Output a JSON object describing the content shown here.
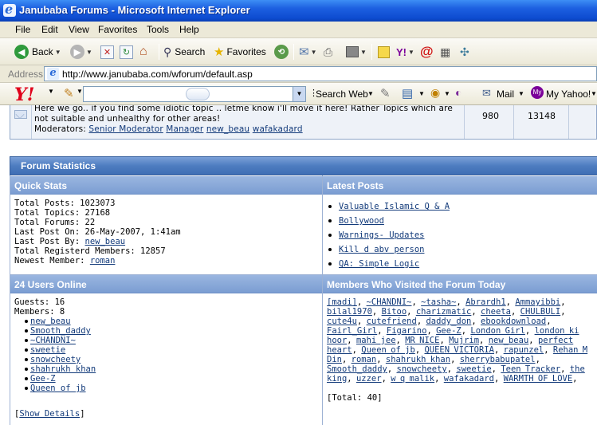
{
  "window": {
    "title": "Janubaba Forums - Microsoft Internet Explorer"
  },
  "menu": [
    "File",
    "Edit",
    "View",
    "Favorites",
    "Tools",
    "Help"
  ],
  "toolbar": {
    "back_label": "Back",
    "search_label": "Search",
    "favorites_label": "Favorites"
  },
  "address": {
    "label": "Address",
    "url": "http://www.janubaba.com/wforum/default.asp"
  },
  "yahoo": {
    "search_web_label": "Search Web",
    "mail_label": "Mail",
    "my_yahoo_label": "My Yahoo!"
  },
  "forum": {
    "description": "Here we go.. if you find some idiotic topic .. letme know i'll move it here! Rather Topics which are not suitable and unhealthy for other areas!",
    "moderators_label": "Moderators:",
    "moderators": [
      "Senior Moderator",
      "Manager",
      "new_beau",
      "wafakadard"
    ],
    "topics": "980",
    "posts": "13148"
  },
  "stats": {
    "title": "Forum Statistics",
    "quick_stats_title": "Quick Stats",
    "latest_posts_title": "Latest Posts",
    "lines": [
      "Total Posts: 1023073",
      "Total Topics: 27168",
      "Total Forums: 22",
      "Last Post On: 26-May-2007, 1:41am"
    ],
    "last_post_by_label": "Last Post By:",
    "last_post_by": "new_beau",
    "registered_line": "Total Registerd Members: 12857",
    "newest_label": "Newest Member:",
    "newest_member": "roman",
    "latest_posts": [
      "Valuable Islamic Q & A",
      "Bollywood",
      "Warnings- Updates",
      "Kill d abv person",
      "QA: Simple Logic"
    ]
  },
  "online": {
    "title": "24 Users Online",
    "guests": "Guests: 16",
    "members": "Members: 8",
    "users": [
      "new_beau",
      "Smooth_daddy",
      "~CHANDNI~",
      "sweetie",
      "snowcheety",
      "shahrukh khan",
      "Gee-Z",
      "Queen of jb"
    ],
    "show_details_open": "[",
    "show_details": "Show Details",
    "show_details_close": "]"
  },
  "visited": {
    "title": "Members Who Visited the Forum Today",
    "members": [
      "[madi]",
      "~CHANDNI~",
      "~tasha~",
      "Abrardh1",
      "Ammayibbi",
      "bilal1970",
      "Bitoo",
      "charizmatic",
      "cheeta",
      "CHULBULI",
      "cute4u",
      "cutefriend",
      "daddy_don",
      "ebookdownload",
      "Fairl_Girl",
      "Figarino",
      "Gee-Z",
      "London Girl",
      "london ki hoor",
      "mahi jee",
      "MR NICE",
      "Mujrim",
      "new_beau",
      "perfect heart",
      "Queen of jb",
      "QUEEN VICTORIA",
      "rapunzel",
      "Rehan M Din",
      "roman",
      "shahrukh khan",
      "sherrybabupatel",
      "Smooth_daddy",
      "snowcheety",
      "sweetie",
      "Teen Tracker",
      "the king",
      "uzzer",
      "w q malik",
      "wafakadard",
      "WARMTH OF LOVE"
    ],
    "total": "[Total: 40]"
  }
}
